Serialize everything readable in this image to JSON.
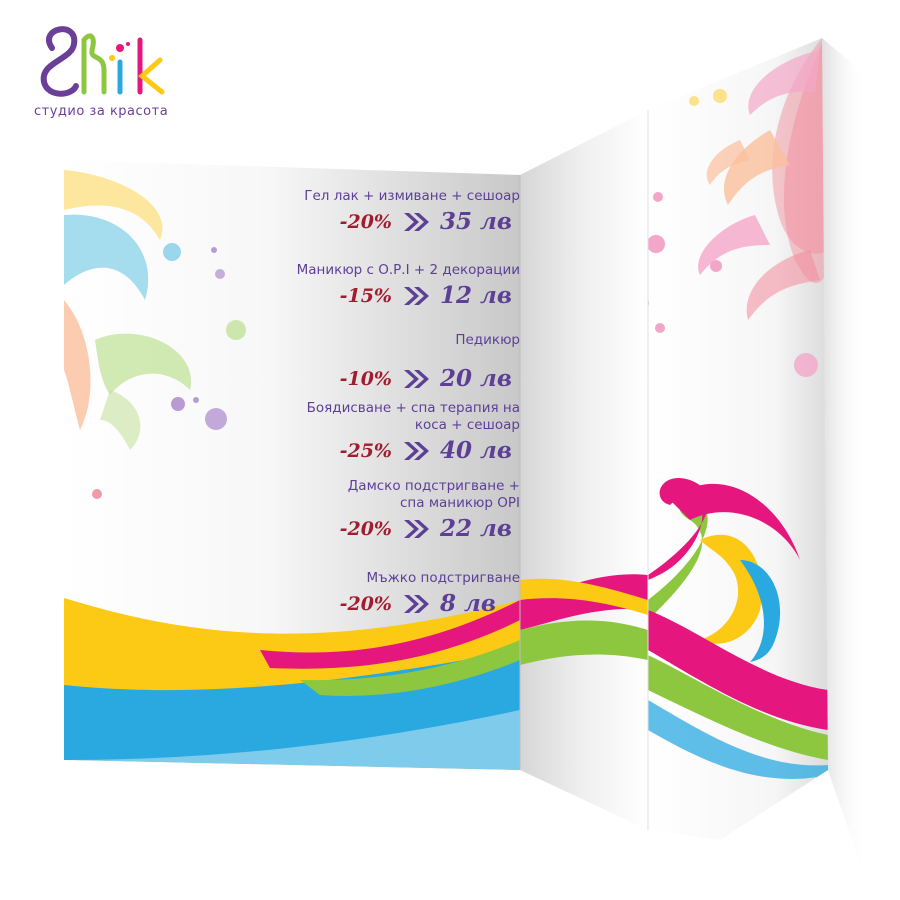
{
  "brand": {
    "logo_text": "Shik",
    "tagline": "студио за красота"
  },
  "colors": {
    "purple": "#5d3f96",
    "red": "#a11c2e",
    "magenta": "#e5177e",
    "yellow": "#fcc914",
    "blue": "#29a9e0",
    "green": "#8dc63f"
  },
  "icons": {
    "arrow": "double-chevron-right-icon"
  },
  "price_list": [
    {
      "service": "Гел лак + измиване + сешоар",
      "discount": "-20%",
      "price": "35 лв"
    },
    {
      "service": "Маникюр с О.Р.I + 2 декорации",
      "discount": "-15%",
      "price": "12 лв"
    },
    {
      "service": "Педикюр",
      "discount": "-10%",
      "price": "20 лв"
    },
    {
      "service": "Боядисване + спа терапия на\nкоса + сешоар",
      "discount": "-25%",
      "price": "40 лв"
    },
    {
      "service": "Дамско подстригване +\nспа маникюр ОРI",
      "discount": "-20%",
      "price": "22 лв"
    },
    {
      "service": "Мъжко подстригване",
      "discount": "-20%",
      "price": "8 лв"
    }
  ]
}
